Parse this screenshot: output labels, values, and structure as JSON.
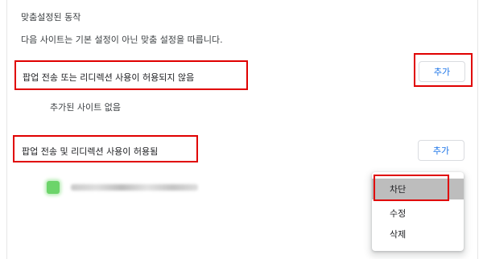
{
  "section": {
    "title": "맞춤설정된 동작",
    "description": "다음 사이트는 기본 설정이 아닌 맞춤 설정을 따릅니다."
  },
  "blocked": {
    "label": "팝업 전송 또는 리디렉션 사용이 허용되지 않음",
    "add_button": "추가",
    "empty_text": "추가된 사이트 없음"
  },
  "allowed": {
    "label": "팝업 전송 및 리디렉션 사용이 허용됨",
    "add_button": "추가",
    "site": {
      "favicon_color": "#6cd46a"
    }
  },
  "context_menu": {
    "items": [
      {
        "label": "차단",
        "selected": true
      },
      {
        "label": "수정",
        "selected": false
      },
      {
        "label": "삭제",
        "selected": false
      }
    ]
  },
  "colors": {
    "highlight": "#e00000",
    "accent": "#1a73e8",
    "menu_selected": "#bdbdbd"
  }
}
